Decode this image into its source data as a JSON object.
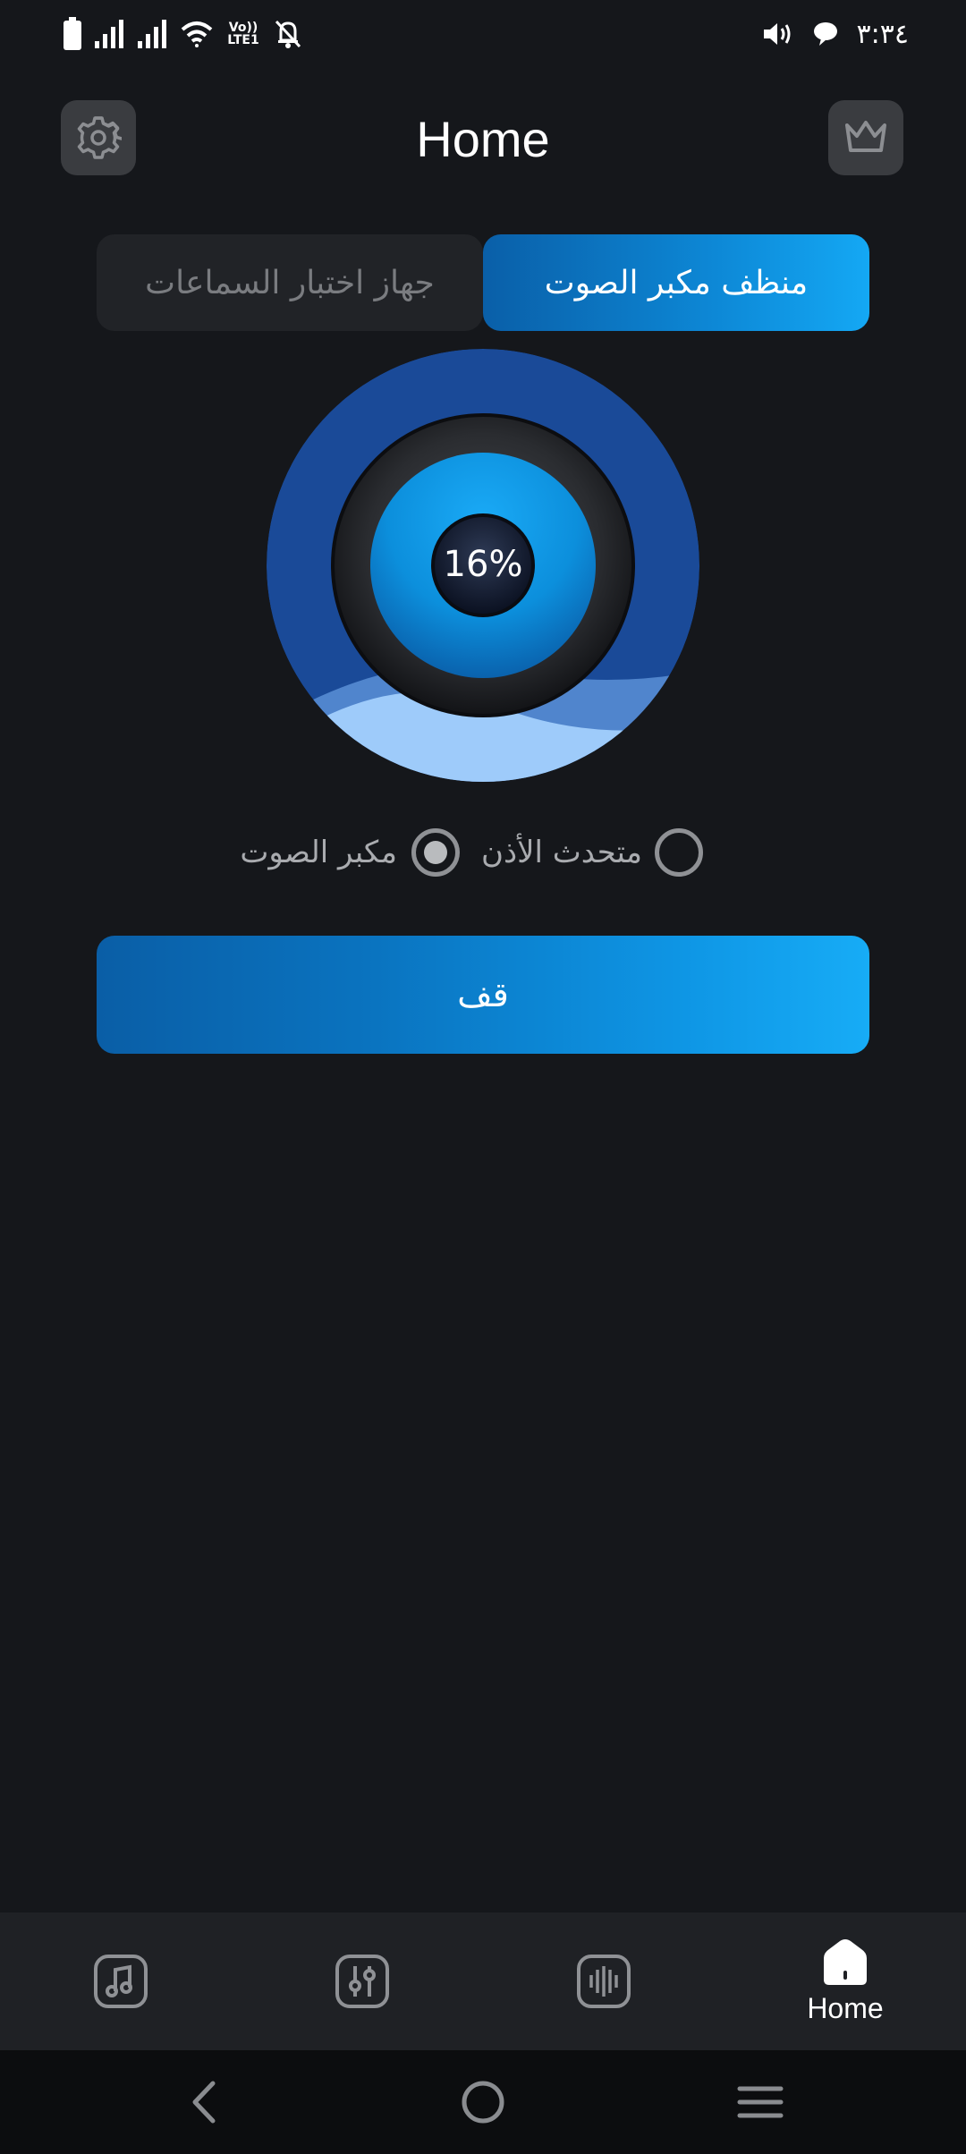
{
  "status_bar": {
    "time": "٣:٣٤",
    "network_label_top": "Vo))",
    "network_label_bottom": "LTE1",
    "icons": [
      "battery-icon",
      "signal-icon",
      "signal-icon",
      "wifi-icon",
      "volte-icon",
      "bell-off-icon",
      "volume-icon",
      "chat-icon"
    ]
  },
  "header": {
    "title": "Home",
    "left_icon": "gear-icon",
    "right_icon": "crown-icon"
  },
  "tabs": [
    {
      "label": "جهاز اختبار السماعات",
      "active": false
    },
    {
      "label": "منظف مكبر الصوت",
      "active": true
    }
  ],
  "dial": {
    "percent_text": "16%",
    "progress": 0.16
  },
  "radio_options": [
    {
      "label": "مكبر الصوت",
      "selected": true
    },
    {
      "label": "متحدث الأذن",
      "selected": false
    }
  ],
  "stop_button": {
    "label": "قف"
  },
  "bottom_nav": {
    "items": [
      {
        "icon": "music-note-icon",
        "active": false
      },
      {
        "icon": "equalizer-icon",
        "active": false
      },
      {
        "icon": "sound-wave-icon",
        "active": false
      },
      {
        "icon": "home-icon",
        "label": "Home",
        "active": true
      }
    ]
  },
  "system_nav": {
    "icons": [
      "back-icon",
      "home-circle-icon",
      "menu-icon"
    ]
  },
  "colors": {
    "background": "#15171b",
    "accent": "#14a8f4",
    "accent_dark": "#0a5ea6",
    "dial_ring": "#1a4a98",
    "wave": "#9ecbfa"
  }
}
